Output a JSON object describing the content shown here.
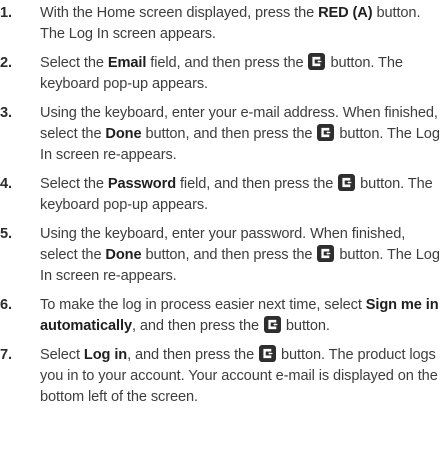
{
  "icon": {
    "name": "enter-button-icon",
    "color": "#2e2e2e"
  },
  "steps": [
    {
      "number": "1.",
      "parts": [
        {
          "t": "With the Home screen displayed, press the "
        },
        {
          "b": "RED (A)"
        },
        {
          "t": " button. The Log In screen appears."
        }
      ]
    },
    {
      "number": "2.",
      "parts": [
        {
          "t": "Select the "
        },
        {
          "b": "Email"
        },
        {
          "t": " field, and then press the "
        },
        {
          "icon": "enter-button-icon"
        },
        {
          "t": " button. The keyboard pop-up appears."
        }
      ]
    },
    {
      "number": "3.",
      "parts": [
        {
          "t": "Using the keyboard, enter your e-mail address. When finished, select the "
        },
        {
          "b": "Done"
        },
        {
          "t": " button, and then press the "
        },
        {
          "icon": "enter-button-icon"
        },
        {
          "t": " button. The Log In screen re-appears."
        }
      ]
    },
    {
      "number": "4.",
      "parts": [
        {
          "t": "Select the "
        },
        {
          "b": "Password"
        },
        {
          "t": " field, and then press the "
        },
        {
          "icon": "enter-button-icon"
        },
        {
          "t": " button. The keyboard pop-up appears."
        }
      ]
    },
    {
      "number": "5.",
      "parts": [
        {
          "t": "Using the keyboard, enter your password. When finished, select the "
        },
        {
          "b": "Done"
        },
        {
          "t": " button, and then press the "
        },
        {
          "icon": "enter-button-icon"
        },
        {
          "t": " button. The Log In screen re-appears."
        }
      ]
    },
    {
      "number": "6.",
      "parts": [
        {
          "t": "To make the log in process easier next time, select "
        },
        {
          "b": "Sign me in automatically"
        },
        {
          "t": ", and then press the "
        },
        {
          "icon": "enter-button-icon"
        },
        {
          "t": " button."
        }
      ]
    },
    {
      "number": "7.",
      "parts": [
        {
          "t": "Select "
        },
        {
          "b": "Log in"
        },
        {
          "t": ", and then press the "
        },
        {
          "icon": "enter-button-icon"
        },
        {
          "t": " button. The product logs you in to your account. Your account e-mail is displayed on the bottom left of the screen."
        }
      ]
    }
  ]
}
